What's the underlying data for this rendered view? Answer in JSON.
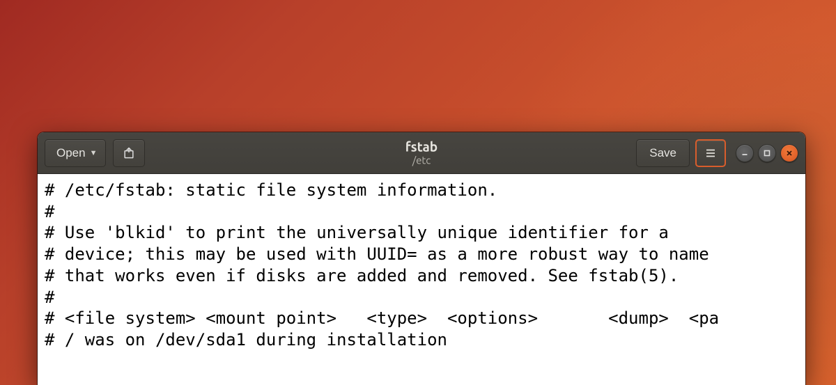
{
  "titlebar": {
    "open_label": "Open",
    "save_label": "Save",
    "filename": "fstab",
    "filepath": "/etc"
  },
  "editor": {
    "content": "# /etc/fstab: static file system information.\n#\n# Use 'blkid' to print the universally unique identifier for a\n# device; this may be used with UUID= as a more robust way to name\n# that works even if disks are added and removed. See fstab(5).\n#\n# <file system> <mount point>   <type>  <options>       <dump>  <pa\n# / was on /dev/sda1 during installation"
  }
}
